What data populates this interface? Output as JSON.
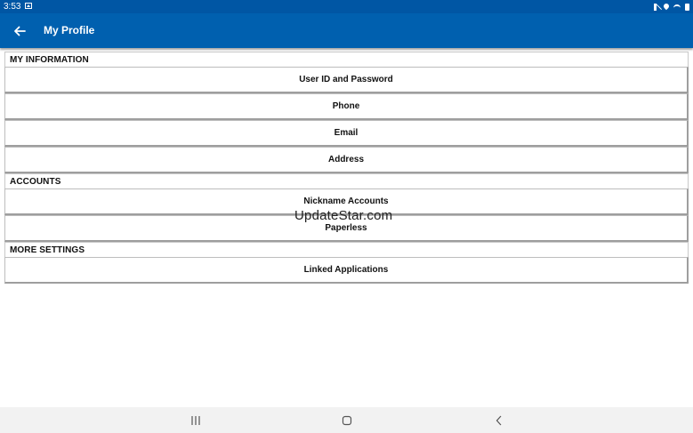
{
  "status_bar": {
    "time": "3:53"
  },
  "app_bar": {
    "title": "My Profile"
  },
  "sections": {
    "my_information": {
      "header": "MY INFORMATION",
      "items": [
        "User ID and Password",
        "Phone",
        "Email",
        "Address"
      ]
    },
    "accounts": {
      "header": "ACCOUNTS",
      "items": [
        "Nickname Accounts",
        "Paperless"
      ]
    },
    "more_settings": {
      "header": "MORE SETTINGS",
      "items": [
        "Linked Applications"
      ]
    }
  },
  "watermark": "UpdateStar.com",
  "colors": {
    "status_bar": "#0056a4",
    "app_bar": "#0060af",
    "nav_bar": "#f2f2f2"
  },
  "icons": {
    "back": "arrow-left-icon",
    "nav_recents": "recents-icon",
    "nav_home": "home-icon",
    "nav_back": "chevron-left-icon"
  }
}
